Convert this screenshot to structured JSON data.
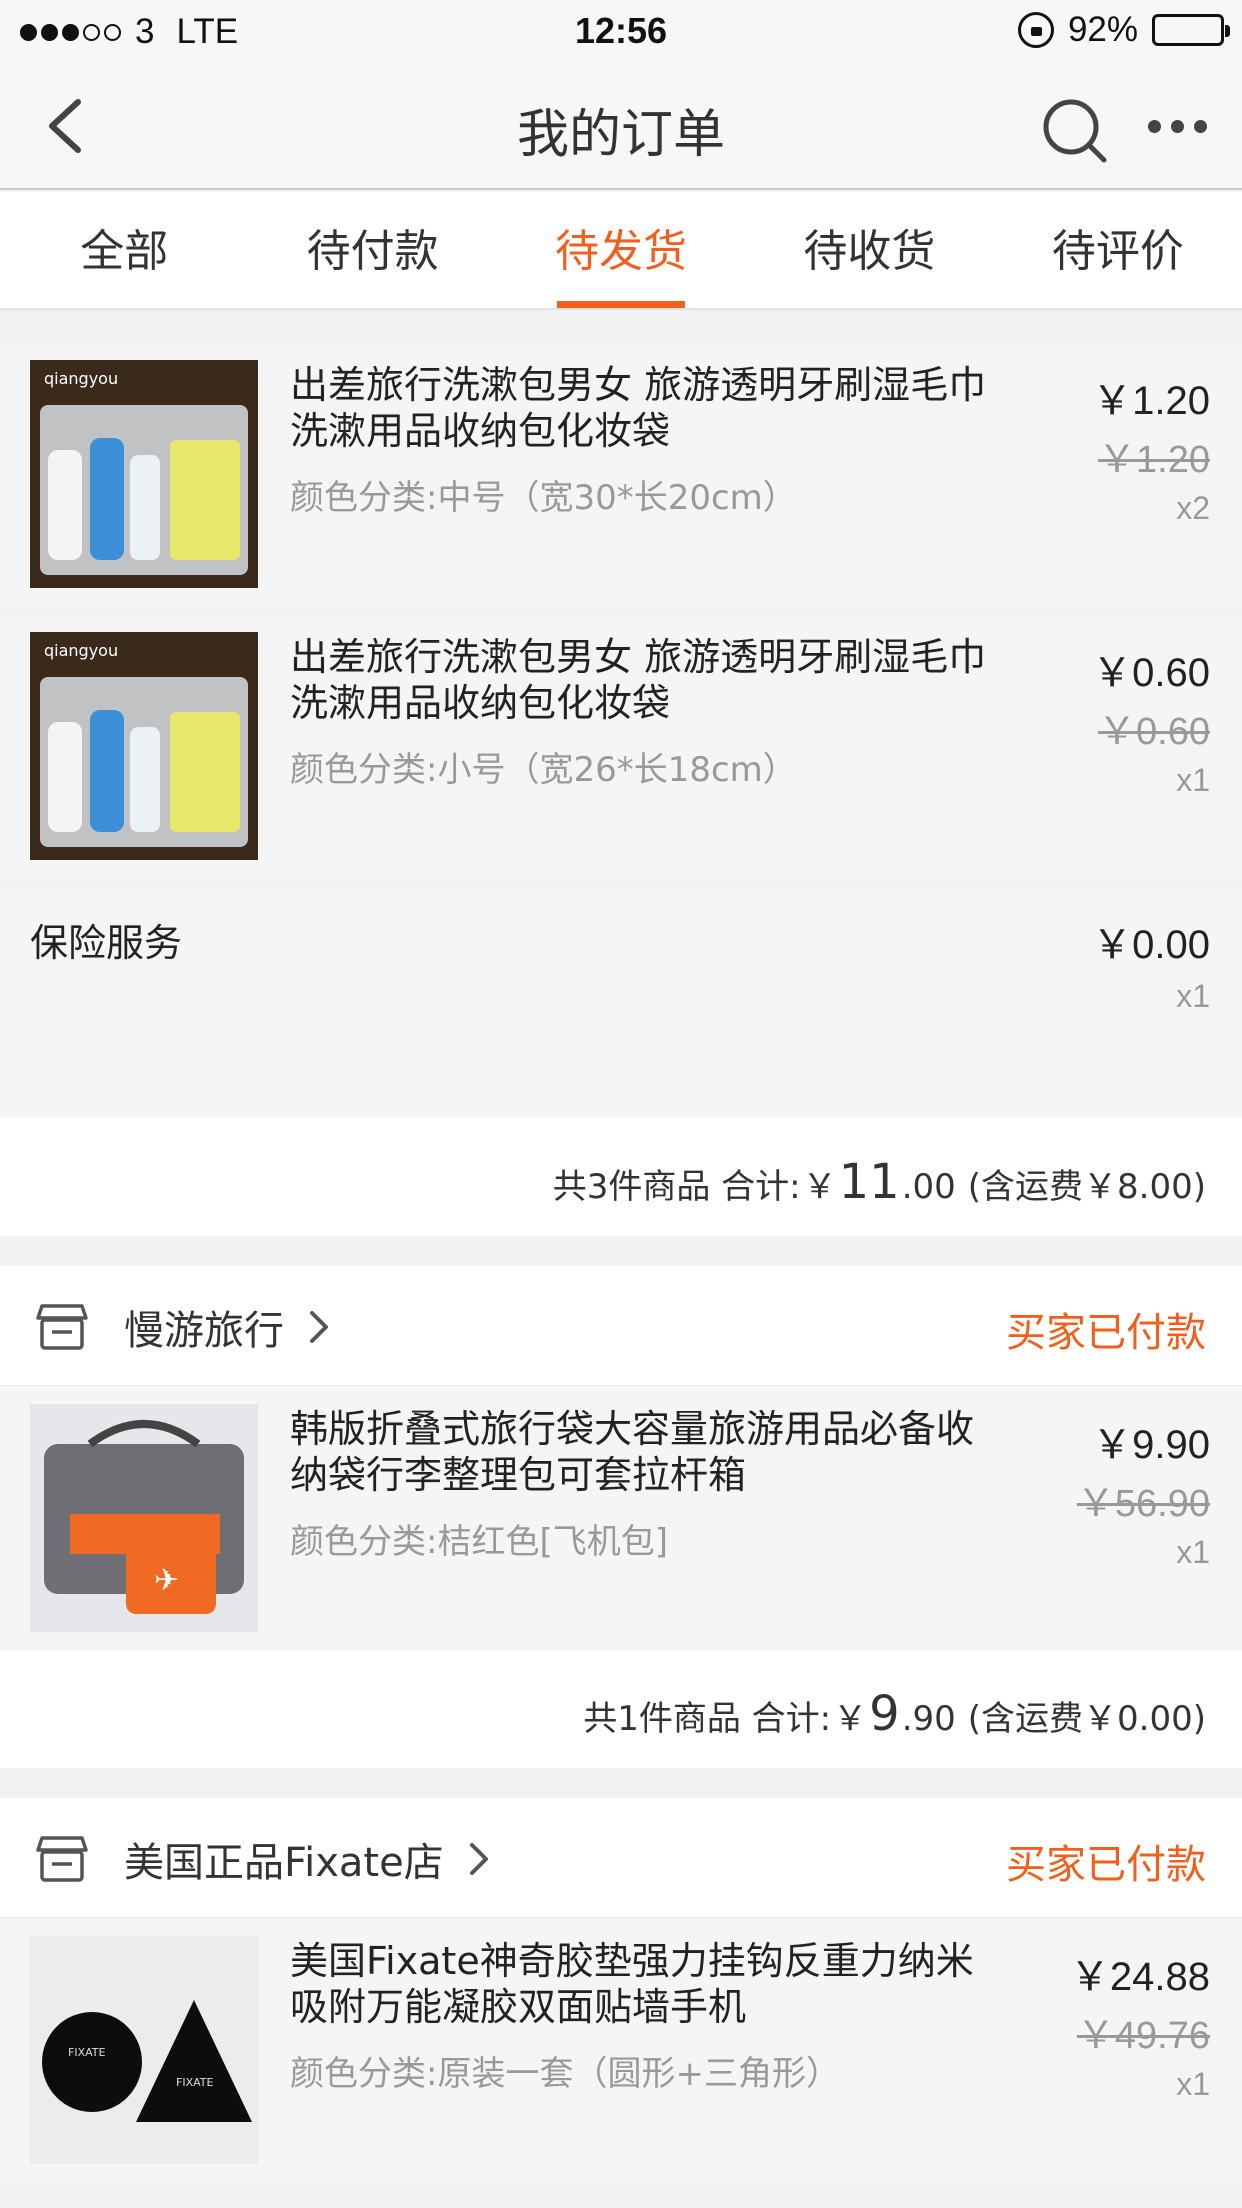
{
  "status_bar": {
    "carrier": "3",
    "network": "LTE",
    "time": "12:56",
    "battery": "92%",
    "signal_filled": 3,
    "signal_total": 5,
    "battery_level": 0.92
  },
  "nav": {
    "title": "我的订单",
    "back_icon": "chevron-left-icon",
    "search_icon": "search-icon",
    "more_icon": "more-icon"
  },
  "tabs": [
    {
      "label": "全部",
      "active": false
    },
    {
      "label": "待付款",
      "active": false
    },
    {
      "label": "待发货",
      "active": true
    },
    {
      "label": "待收货",
      "active": false
    },
    {
      "label": "待评价",
      "active": false
    }
  ],
  "accent_color": "#f25f1c",
  "order1": {
    "items": [
      {
        "name": "出差旅行洗漱包男女 旅游透明牙刷湿毛巾洗漱用品收纳包化妆袋",
        "sku": "颜色分类:中号（宽30*长20cm）",
        "price": "￥1.20",
        "original_price": "￥1.20",
        "qty": "x2"
      },
      {
        "name": "出差旅行洗漱包男女 旅游透明牙刷湿毛巾洗漱用品收纳包化妆袋",
        "sku": "颜色分类:小号（宽26*长18cm）",
        "price": "￥0.60",
        "original_price": "￥0.60",
        "qty": "x1"
      }
    ],
    "insurance": {
      "name": "保险服务",
      "price": "￥0.00",
      "qty": "x1"
    },
    "summary": {
      "count": "共3件商品 合计:",
      "currency": "￥",
      "int": "11",
      "dec": ".00",
      "shipping": "(含运费￥8.00)"
    }
  },
  "order2": {
    "shop": "慢游旅行",
    "status": "买家已付款",
    "item": {
      "name": "韩版折叠式旅行袋大容量旅游用品必备收纳袋行李整理包可套拉杆箱",
      "sku": "颜色分类:桔红色[飞机包]",
      "price": "￥9.90",
      "original_price": "￥56.90",
      "qty": "x1"
    },
    "summary": {
      "count": "共1件商品 合计:",
      "currency": "￥",
      "int": "9",
      "dec": ".90",
      "shipping": "(含运费￥0.00)"
    }
  },
  "order3": {
    "shop": "美国正品Fixate店",
    "status": "买家已付款",
    "item": {
      "name": "美国Fixate神奇胶垫强力挂钩反重力纳米吸附万能凝胶双面贴墙手机",
      "sku": "颜色分类:原装一套（圆形+三角形）",
      "price": "￥24.88",
      "original_price": "￥49.76",
      "qty": "x1"
    }
  }
}
